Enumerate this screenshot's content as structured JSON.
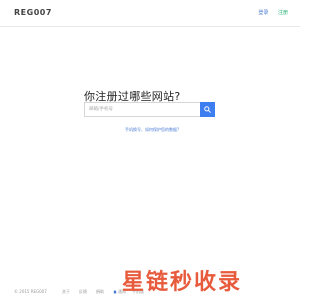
{
  "header": {
    "logo": "REG007",
    "login_label": "登录",
    "register_label": "注册"
  },
  "main": {
    "headline": "你注册过哪些网站?",
    "search_placeholder": "邮箱/手机号",
    "help_link": "手机换号、如何保护您的数据?"
  },
  "footer": {
    "copyright": "© 2015 REG007",
    "about": "关于",
    "feedback": "反馈",
    "donate": "捐助",
    "notify": "通知",
    "mobile": "手机版"
  },
  "watermark": "星链秒收录",
  "colors": {
    "accent": "#3d7ef0",
    "link": "#4a7bd3",
    "register": "#2ab27b",
    "watermark": "#e85a3c"
  },
  "icons": {
    "search_button": "search-icon",
    "notify": "bell-icon"
  }
}
